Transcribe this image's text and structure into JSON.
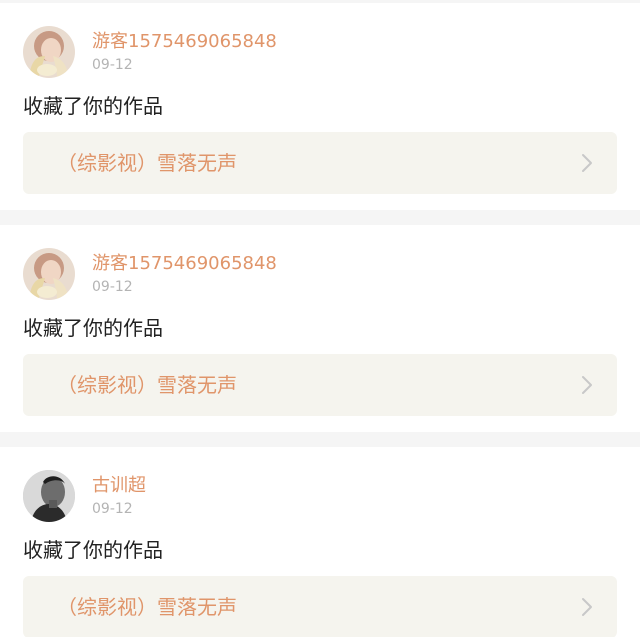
{
  "notifications": [
    {
      "avatar": "avatar-blonde-girl",
      "username": "游客1575469065848",
      "date": "09-12",
      "action": "收藏了你的作品",
      "work_title": "（综影视）雪落无声",
      "chevron": "chevron-right-icon"
    },
    {
      "avatar": "avatar-blonde-girl",
      "username": "游客1575469065848",
      "date": "09-12",
      "action": "收藏了你的作品",
      "work_title": "（综影视）雪落无声",
      "chevron": "chevron-right-icon"
    },
    {
      "avatar": "avatar-monochrome-man",
      "username": "古训超",
      "date": "09-12",
      "action": "收藏了你的作品",
      "work_title": "（综影视）雪落无声",
      "chevron": "chevron-right-icon"
    }
  ],
  "colors": {
    "background": "#f5f5f5",
    "card": "#ffffff",
    "username": "#e0956a",
    "date": "#b4b4b4",
    "action_text": "#222222",
    "link_bg": "#f5f4ee",
    "chevron": "#c8c8c8"
  }
}
